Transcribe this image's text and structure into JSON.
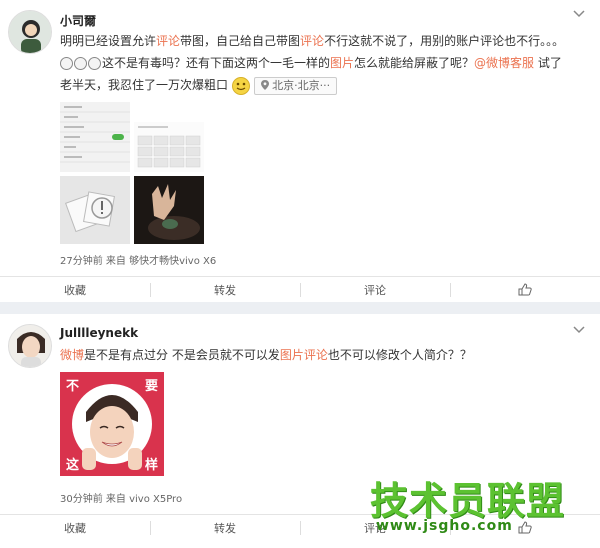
{
  "post1": {
    "username": "小司爾",
    "text_parts": [
      "明明已经设置允许",
      "评论",
      "带图，自己给自己带图",
      "评论",
      "不行这就不说了，用别的账户评论也不行。。。"
    ],
    "text2_parts": [
      "这不是有毒吗？还有下面这两个一毛一样的",
      "图片",
      "怎么就能给屏蔽了呢？",
      "@微博客服",
      " 试了"
    ],
    "text3": "老半天，我忍住了一万次爆粗口",
    "location": "北京·北京···",
    "meta": "27分钟前 来自 够快才畅快vivo X6",
    "actions": [
      "收藏",
      "转发",
      "评论",
      ""
    ]
  },
  "post2": {
    "username": "Julllleynekk",
    "text_parts": [
      "微博",
      "是不是有点过分 不是会员就不可以发",
      "图片评论",
      "也不可以修改个人简介？？"
    ],
    "sticker_top_left": "不",
    "sticker_top_right": "要",
    "sticker_bottom_left": "这",
    "sticker_bottom_right": "样",
    "meta": "30分钟前 来自 vivo X5Pro",
    "actions": [
      "收藏",
      "转发",
      "评论",
      ""
    ]
  },
  "watermark": {
    "title": "技术员联盟",
    "url": "www.jsgho.com"
  },
  "icons": [
    "chevron-down-icon",
    "location-pin-icon",
    "thumbs-up-icon",
    "smile-emoji-icon",
    "broken-image-icon"
  ],
  "colors": {
    "highlight": "#eb7350",
    "watermark_green": "#5cc231",
    "sticker_red": "#d9334d"
  }
}
